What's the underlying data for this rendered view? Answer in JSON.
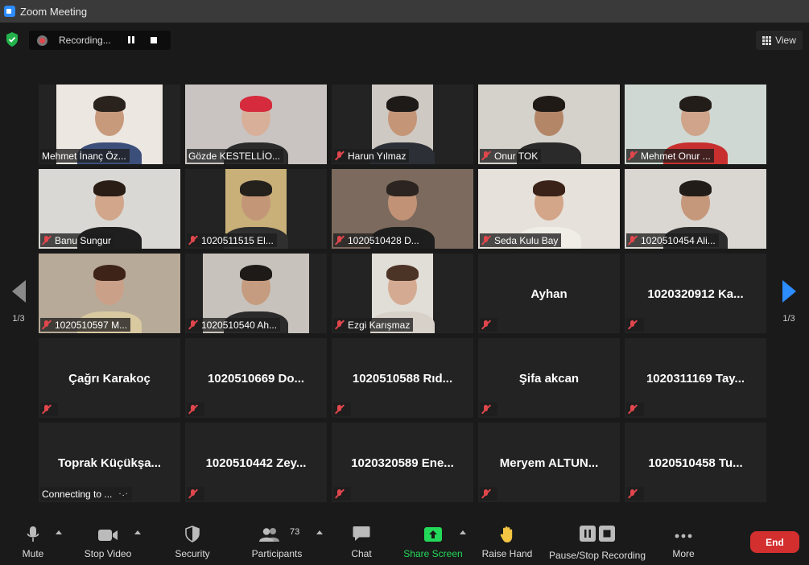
{
  "window": {
    "title": "Zoom Meeting"
  },
  "recording": {
    "status_text": "Recording..."
  },
  "view": {
    "label": "View"
  },
  "pagination": {
    "left": "1/3",
    "right": "1/3"
  },
  "participants": [
    {
      "name": "Mehmet İnanç Öz...",
      "has_video": true,
      "muted": false,
      "bg": "#ece7e1",
      "skin": "#c89a7c",
      "shirt": "#3b4f7a",
      "hair": "#2a221c"
    },
    {
      "name": "Gözde KESTELLİO...",
      "has_video": true,
      "muted": false,
      "active": true,
      "bg": "#c9c4c2",
      "skin": "#d8b09a",
      "shirt": "#2b2b2b",
      "hair": "#d52b3c"
    },
    {
      "name": "Harun Yılmaz",
      "has_video": true,
      "muted": true,
      "bg": "#cfc9c3",
      "skin": "#c49577",
      "shirt": "#2c2f35",
      "hair": "#1d1a18"
    },
    {
      "name": "Onur TOK",
      "has_video": true,
      "muted": true,
      "bg": "#d5d2cc",
      "skin": "#b48668",
      "shirt": "#2a2a2a",
      "hair": "#201a16"
    },
    {
      "name": "Mehmet Onur ...",
      "has_video": true,
      "muted": true,
      "bg": "#cfd8d2",
      "skin": "#cfa48a",
      "shirt": "#c7302e",
      "hair": "#231d19"
    },
    {
      "name": "Banu Sungur",
      "has_video": true,
      "muted": true,
      "bg": "#d9d8d4",
      "skin": "#d1a68b",
      "shirt": "#1f1f1f",
      "hair": "#2a1d16"
    },
    {
      "name": "1020511515  El...",
      "has_video": true,
      "muted": true,
      "bg": "#c9b079",
      "skin": "#c49678",
      "shirt": "#2f2f2f",
      "hair": "#24201c"
    },
    {
      "name": "1020510428 D...",
      "has_video": true,
      "muted": true,
      "bg": "#7b6a5d",
      "skin": "#c19276",
      "shirt": "#1e1e1e",
      "hair": "#2b2420"
    },
    {
      "name": "Seda Kulu Bay",
      "has_video": true,
      "muted": true,
      "bg": "#e6e1da",
      "skin": "#d3a589",
      "shirt": "#f0ece6",
      "hair": "#3a2218"
    },
    {
      "name": "1020510454 Ali...",
      "has_video": true,
      "muted": true,
      "bg": "#dad6d1",
      "skin": "#c6987b",
      "shirt": "#2c2c2c",
      "hair": "#221c18"
    },
    {
      "name": "1020510597 M...",
      "has_video": true,
      "muted": true,
      "bg": "#b7aa98",
      "skin": "#caa088",
      "shirt": "#d8c9a1",
      "hair": "#3e2418"
    },
    {
      "name": "1020510540 Ah...",
      "has_video": true,
      "muted": true,
      "bg": "#c7c2bc",
      "skin": "#c69c80",
      "shirt": "#2a2a2a",
      "hair": "#1e1a18"
    },
    {
      "name": "Ezgi Karışmaz",
      "has_video": true,
      "muted": true,
      "bg": "#e1ddd7",
      "skin": "#d4ab92",
      "shirt": "#d7d1c9",
      "hair": "#4b3325"
    },
    {
      "name": "Ayhan",
      "has_video": false,
      "muted": true
    },
    {
      "name": "1020320912  Ka...",
      "has_video": false,
      "muted": true
    },
    {
      "name": "Çağrı Karakoç",
      "has_video": false,
      "muted": true
    },
    {
      "name": "1020510669  Do...",
      "has_video": false,
      "muted": true
    },
    {
      "name": "1020510588  Rıd...",
      "has_video": false,
      "muted": true
    },
    {
      "name": "Şifa akcan",
      "has_video": false,
      "muted": true
    },
    {
      "name": "1020311169  Tay...",
      "has_video": false,
      "muted": true
    },
    {
      "name": "Toprak  Küçükşa...",
      "has_video": false,
      "muted": false,
      "status": "Connecting to ..."
    },
    {
      "name": "1020510442  Zey...",
      "has_video": false,
      "muted": true
    },
    {
      "name": "1020320589  Ene...",
      "has_video": false,
      "muted": true
    },
    {
      "name": "Meryem  ALTUN...",
      "has_video": false,
      "muted": true
    },
    {
      "name": "1020510458  Tu...",
      "has_video": false,
      "muted": true
    }
  ],
  "toolbar": {
    "mute": "Mute",
    "stop_video": "Stop Video",
    "security": "Security",
    "participants": "Participants",
    "participants_count": "73",
    "chat": "Chat",
    "share_screen": "Share Screen",
    "raise_hand": "Raise Hand",
    "pause_stop_recording": "Pause/Stop Recording",
    "more": "More",
    "end": "End"
  },
  "colors": {
    "accent": "#2d8cff",
    "share_green": "#23d959",
    "end_red": "#d32f2f",
    "active_speaker": "#c5e063",
    "muted_red": "#e0474c"
  }
}
